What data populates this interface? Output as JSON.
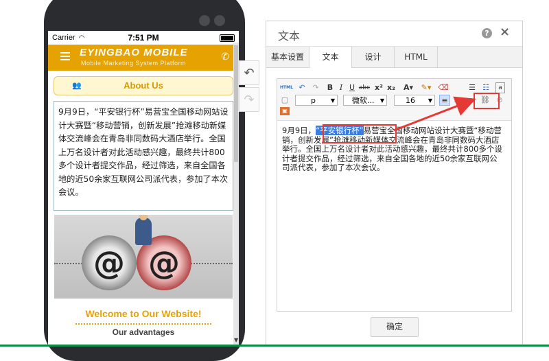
{
  "phone": {
    "carrier": "Carrier",
    "time": "7:51 PM",
    "brand": "EYINGBAO MOBILE",
    "brand_sub": "Mobile Marketing System Platform",
    "about_label": "About Us",
    "article": "9月9日，“平安银行杯”易营宝全国移动网站设计大赛暨“移动营销，创新发展”抢滩移动新媒体交流峰会在青岛非同数码大酒店举行。全国上万名设计者对此活动感兴趣，最终共计800多个设计者提交作品，经过筛选，来自全国各地的近50余家互联网公司派代表，参加了本次会议。",
    "welcome": "Welcome to Our Website!",
    "advantages": "Our advantages"
  },
  "dialog": {
    "title": "文本",
    "tabs": [
      {
        "label": "基本设置"
      },
      {
        "label": "文本"
      },
      {
        "label": "设计"
      },
      {
        "label": "HTML"
      }
    ],
    "toolbar": {
      "html_label": "HTML",
      "format_value": "p",
      "font_value": "微软...",
      "size_value": "16"
    },
    "editor": {
      "text_before": "9月9日，",
      "text_selected": "“平安银行杯”",
      "text_after": "易营宝全国移动网站设计大赛暨“移动营销，创新发展”抢滩移动新媒体交流峰会在青岛非同数码大酒店举行。全国上万名设计者对此活动感兴趣，最终共计800多个设计者提交作品，经过筛选，来自全国各地的近50余家互联网公司派代表，参加了本次会议。"
    },
    "ok_label": "确定"
  },
  "colors": {
    "brand": "#e6a200",
    "annotation": "#e53935",
    "selection": "#3b7de0"
  }
}
